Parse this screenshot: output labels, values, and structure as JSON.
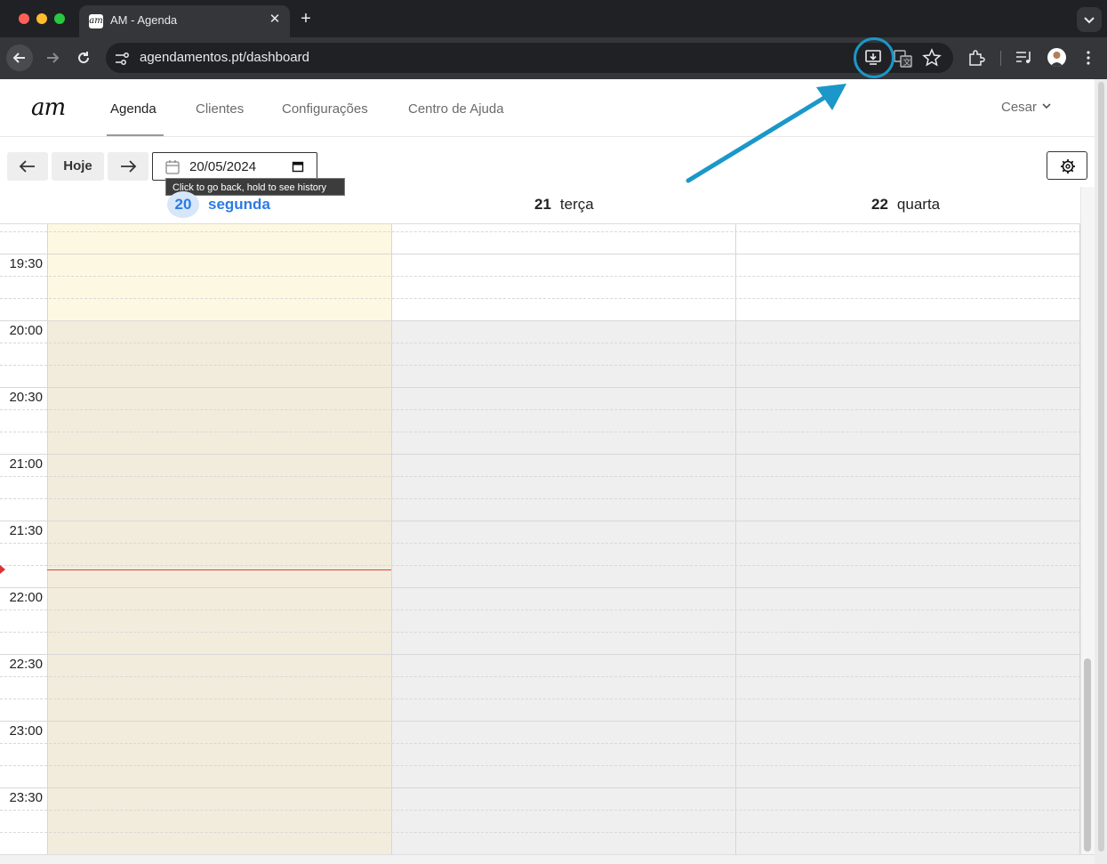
{
  "browser": {
    "tab_title": "AM - Agenda",
    "favicon_text": "am",
    "tab_close": "✕",
    "new_tab": "+",
    "url": "agendamentos.pt/dashboard",
    "icons": [
      "back-icon",
      "forward-icon",
      "reload-icon",
      "site-info-icon",
      "install-app-icon",
      "translate-icon",
      "bookmark-star-icon",
      "extensions-icon",
      "media-icon",
      "profile-avatar",
      "menu-icon"
    ]
  },
  "app": {
    "logo": "am",
    "nav": [
      {
        "label": "Agenda",
        "active": true
      },
      {
        "label": "Clientes",
        "active": false
      },
      {
        "label": "Configurações",
        "active": false
      },
      {
        "label": "Centro de Ajuda",
        "active": false
      }
    ],
    "user": "Cesar"
  },
  "calendar": {
    "today_label": "Hoje",
    "date_value": "20/05/2024",
    "tooltip": "Click to go back, hold to see history",
    "days": [
      {
        "num": "20",
        "name": "segunda",
        "today": true
      },
      {
        "num": "21",
        "name": "terça",
        "today": false
      },
      {
        "num": "22",
        "name": "quarta",
        "today": false
      }
    ],
    "times": [
      "19:30",
      "20:00",
      "20:30",
      "21:00",
      "21:30",
      "22:00",
      "22:30",
      "23:00",
      "23:30"
    ]
  },
  "colors": {
    "today_column": "#fdf8e1",
    "today_column_after_hours": "#f2ecdc",
    "after_hours": "#efefef",
    "accent_blue": "#2b7be4",
    "now_line": "#e0403a",
    "annotation": "#1b97c9"
  }
}
